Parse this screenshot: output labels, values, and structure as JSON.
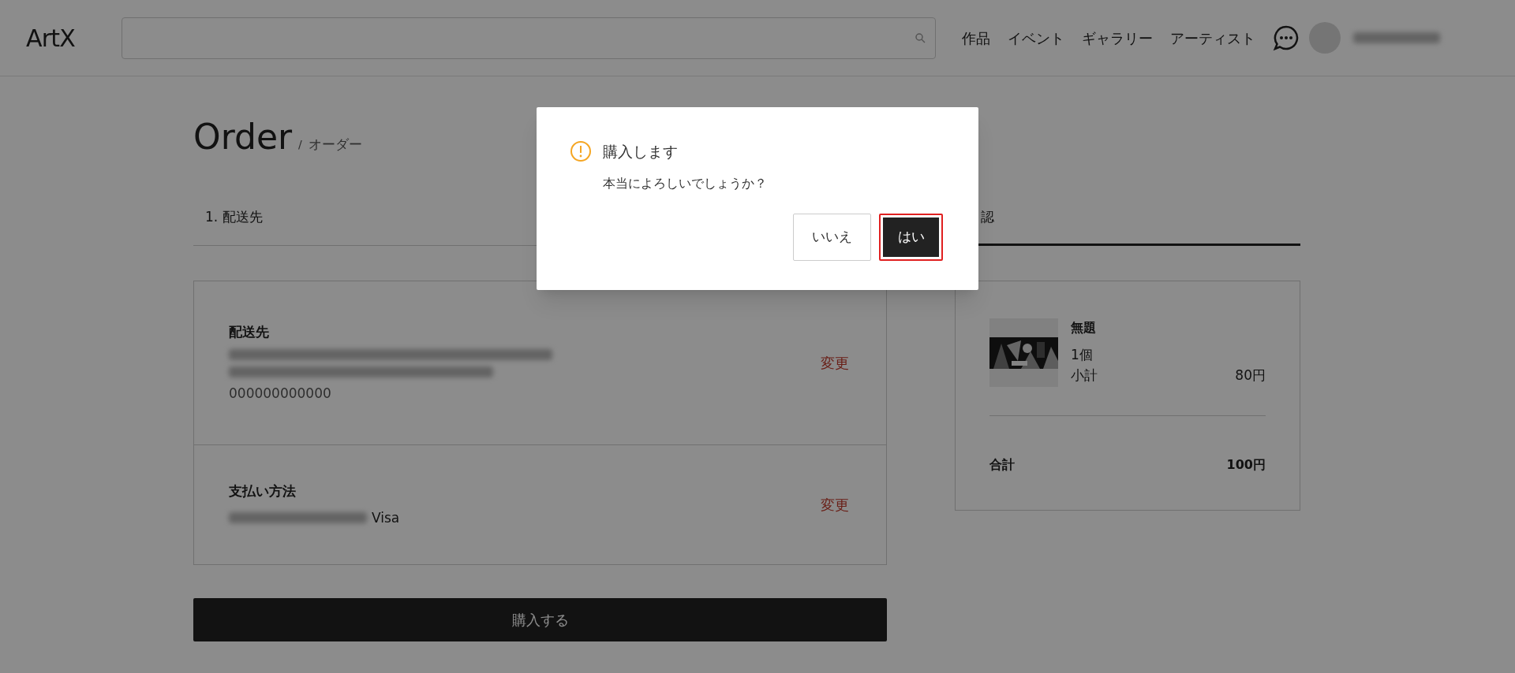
{
  "header": {
    "logo": "ArtX",
    "nav": [
      "作品",
      "イベント",
      "ギャラリー",
      "アーティスト"
    ]
  },
  "page": {
    "title": "Order",
    "separator": "/",
    "subtitle": "オーダー"
  },
  "tabs": [
    {
      "label": "1. 配送先",
      "selected": false
    },
    {
      "label": "認",
      "selected": true
    }
  ],
  "shipping": {
    "heading": "配送先",
    "phone": "000000000000",
    "change": "変更"
  },
  "payment": {
    "heading": "支払い方法",
    "card_brand": "Visa",
    "change": "変更"
  },
  "order_item": {
    "title": "無題",
    "quantity": "1個",
    "subtotal_label": "小計",
    "subtotal": "80円"
  },
  "total": {
    "label": "合計",
    "value": "100円"
  },
  "buy_button": "購入する",
  "dialog": {
    "title": "購入します",
    "message": "本当によろしいでしょうか？",
    "buttons": [
      {
        "label": "いいえ",
        "kind": "secondary",
        "focused": false
      },
      {
        "label": "はい",
        "kind": "primary",
        "focused": true
      }
    ]
  }
}
